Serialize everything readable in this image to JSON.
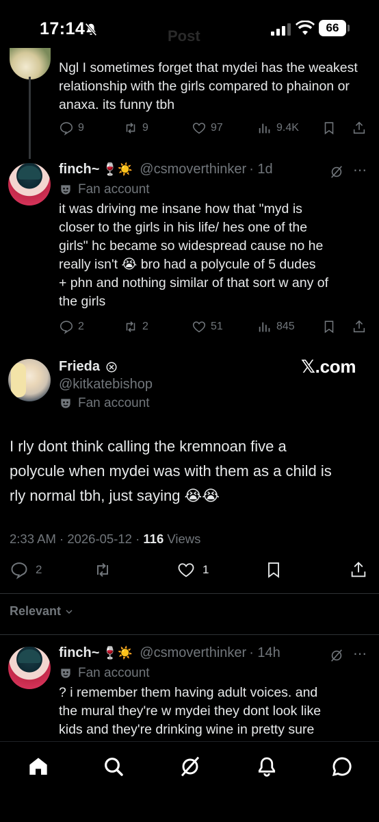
{
  "status_bar": {
    "time": "17:14",
    "battery": "66",
    "faded_title": "Post"
  },
  "tweet1": {
    "text": "Ngl I sometimes forget that mydei has the weakest relationship with the girls compared to phainon or anaxa. its funny tbh",
    "replies": "9",
    "reposts": "9",
    "likes": "97",
    "views": "9.4K"
  },
  "tweet2": {
    "name": "finch~",
    "emojis": "🍷☀️",
    "handle": "@csmoverthinker",
    "time": "· 1d",
    "fan_label": "Fan account",
    "text_lines": [
      "it was driving me insane how that \"myd is",
      "closer to the girls in his life/ hes one of the",
      "girls\" hc became so widespread cause no he",
      "really isn't 😭 bro had a polycule of 5 dudes",
      "+ phn and nothing similar of that sort w any of",
      "the girls"
    ],
    "replies": "2",
    "reposts": "2",
    "likes": "51",
    "views": "845"
  },
  "main_post": {
    "name": "Frieda",
    "handle": "@kitkatebishop",
    "fan_label": "Fan account",
    "watermark": "𝕏.com",
    "text_lines": [
      "I rly dont think calling the kremnoan five a",
      "polycule when mydei was with them as a child is",
      "rly normal tbh, just saying 😭😭"
    ],
    "time": "2:33 AM · 2026-05-12 · ",
    "views_count": "116",
    "views_label": " Views",
    "replies": "2",
    "likes": "1"
  },
  "sort_label": "Relevant",
  "reply1": {
    "name": "finch~",
    "emojis": "🍷☀️",
    "handle": "@csmoverthinker",
    "time": "· 14h",
    "fan_label": "Fan account",
    "text_lines": [
      "? i remember them having adult voices. and",
      "the mural they're w mydei they dont look like",
      "kids and they're drinking wine in pretty sure"
    ]
  },
  "nav": [
    "home-icon",
    "search-icon",
    "grok-icon",
    "notifications-icon",
    "messages-icon"
  ],
  "colors": {
    "background": "#000000",
    "text": "#e7e9ea",
    "muted": "#71767b",
    "divider": "#2f3336"
  }
}
